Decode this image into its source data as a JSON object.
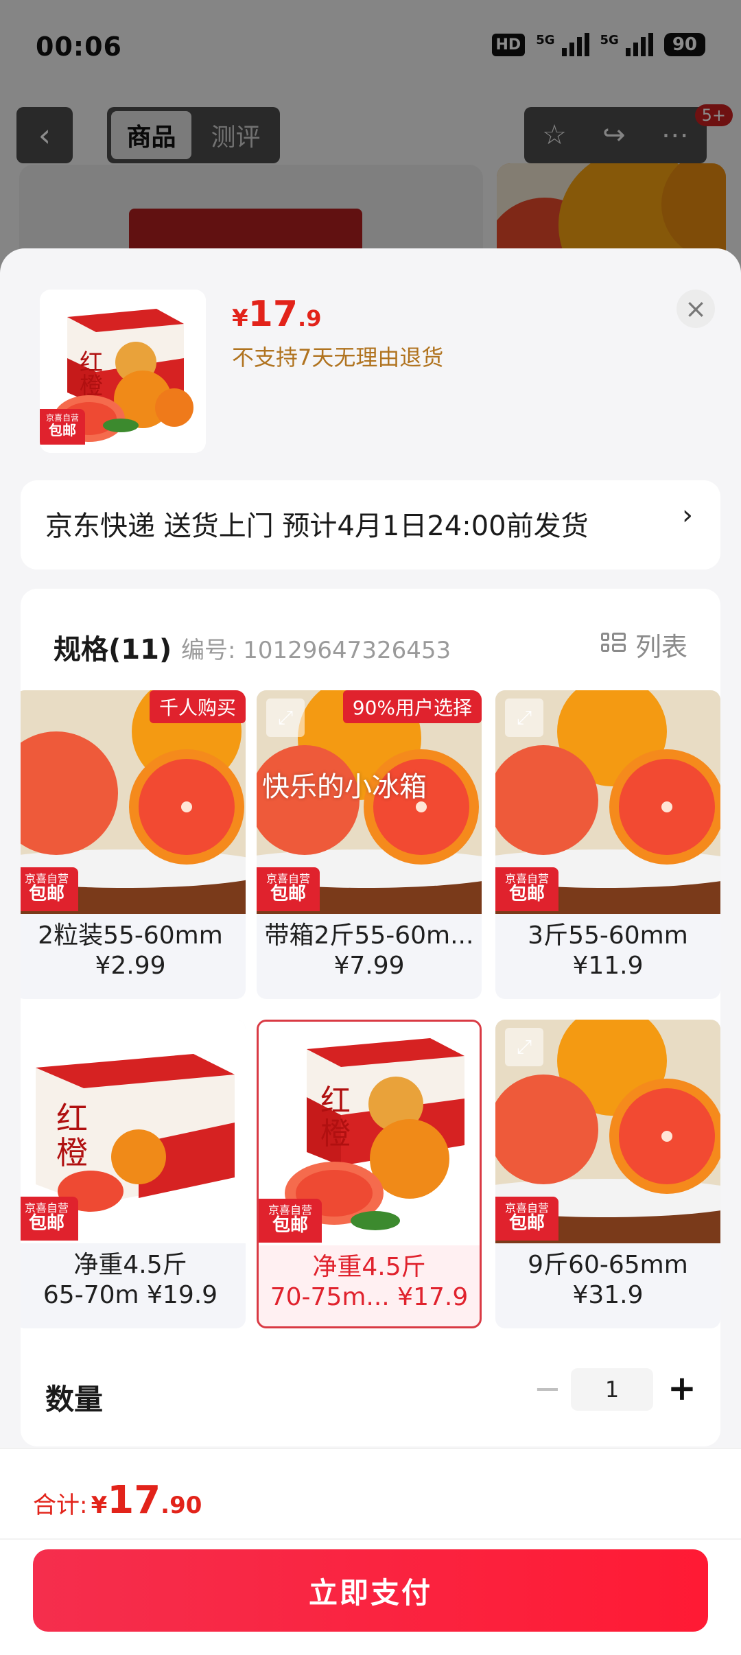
{
  "status_bar": {
    "time": "00:06",
    "hd": "HD",
    "net1": "5G",
    "net2": "5G",
    "battery": "90"
  },
  "nav": {
    "tabs": [
      {
        "label": "商品"
      },
      {
        "label": "测评"
      }
    ],
    "message_count": "5+"
  },
  "sheet": {
    "price": {
      "currency": "¥",
      "integer": "17",
      "decimal": ".9"
    },
    "return_note": "不支持7天无理由退货",
    "header_ship_tag": {
      "brand": "京喜自营",
      "label": "包邮"
    },
    "delivery_text": "京东快递 送货上门 预计4月1日24:00前发货",
    "delivery_arrow": "›",
    "close_icon": "×",
    "spec": {
      "title": "规格(11)",
      "code": "编号: 10129647326453",
      "list_label": "列表",
      "options": [
        {
          "label": "2粒装55-60mm",
          "price": "¥2.99",
          "badge": "千人购买",
          "ship_brand": "京喜自营",
          "ship_label": "包邮"
        },
        {
          "label": "带箱2斤55-60m...",
          "price": "¥7.99",
          "badge": "90%用户选择",
          "watermark": "快乐的小冰箱",
          "ship_brand": "京喜自营",
          "ship_label": "包邮"
        },
        {
          "label": "3斤55-60mm",
          "price": "¥11.9",
          "ship_brand": "京喜自营",
          "ship_label": "包邮"
        },
        {
          "label": "净重4.5斤",
          "price_line": "65-70m ¥19.9",
          "ship_brand": "京喜自营",
          "ship_label": "包邮"
        },
        {
          "label": "净重4.5斤",
          "price_line": "70-75m... ¥17.9",
          "ship_brand": "京喜自营",
          "ship_label": "包邮",
          "selected": true
        },
        {
          "label": "9斤60-65mm",
          "price": "¥31.9",
          "ship_brand": "京喜自营",
          "ship_label": "包邮"
        }
      ]
    },
    "quantity": {
      "label": "数量",
      "value": "1",
      "minus": "−",
      "plus": "+"
    }
  },
  "footer": {
    "total_label": "合计:",
    "total": {
      "currency": "¥",
      "integer": "17",
      "decimal": ".90"
    },
    "pay_button": "立即支付"
  },
  "colors": {
    "accent": "#e2231a",
    "pay_start": "#f52e4d",
    "pay_end": "#ff1a34",
    "note": "#b0731f"
  }
}
